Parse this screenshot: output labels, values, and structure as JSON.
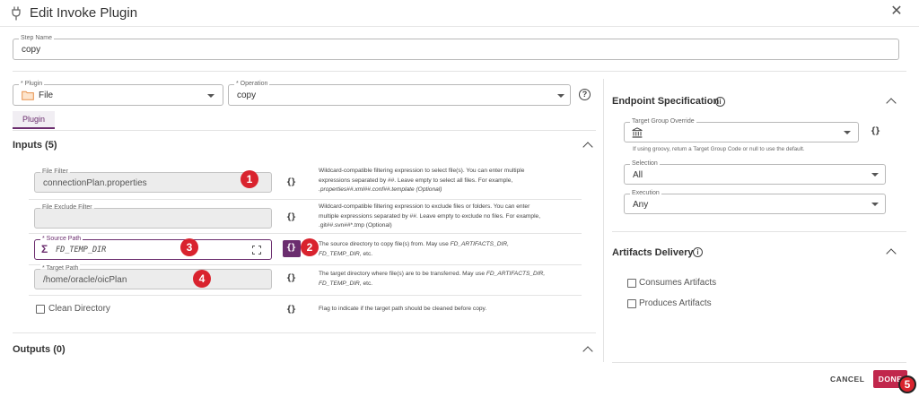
{
  "header": {
    "title": "Edit Invoke Plugin"
  },
  "step_name": {
    "label": "Step Name",
    "value": "copy"
  },
  "plugin": {
    "label": "* Plugin",
    "value": "File"
  },
  "operation": {
    "label": "* Operation",
    "value": "copy"
  },
  "tabs": [
    {
      "label": "Plugin"
    }
  ],
  "inputs": {
    "title": "Inputs (5)",
    "file_filter": {
      "label": "File Filter",
      "value": "connectionPlan.properties",
      "desc_line1": "Wildcard-compatible filtering expression to select file(s). You can enter multiple",
      "desc_line2": "expressions separated by ##. Leave empty to select all files. For example,",
      "desc_line3": ".properties##.xml##.conf##.template (Optional)"
    },
    "file_exclude_filter": {
      "label": "File Exclude Filter",
      "value": "",
      "desc_line1": "Wildcard-compatible filtering expression to exclude files or folders. You can enter",
      "desc_line2": "multiple expressions separated by ##. Leave empty to exclude no files. For example,",
      "desc_line3": ".git##.svn##*.tmp (Optional)"
    },
    "source_path": {
      "label": "* Source Path",
      "value": "FD_TEMP_DIR",
      "desc_line1_prefix": "The source directory to copy file(s) from. May use ",
      "desc_line1_var": "FD_ARTIFACTS_DIR,",
      "desc_line2_var": "FD_TEMP_DIR,",
      "desc_line2_suffix": " etc."
    },
    "target_path": {
      "label": "* Target Path",
      "value": "/home/oracle/oicPlan",
      "desc_line1_prefix": "The target directory where file(s) are to be transferred. May use ",
      "desc_line1_var": "FD_ARTIFACTS_DIR,",
      "desc_line2_var": "FD_TEMP_DIR,",
      "desc_line2_suffix": " etc."
    },
    "clean_directory": {
      "label": "Clean Directory",
      "desc": "Flag to indicate if the target path should be cleaned before copy."
    },
    "braces": "{}"
  },
  "outputs": {
    "title": "Outputs (0)"
  },
  "endpoint": {
    "title": "Endpoint Specification",
    "target_group_override": {
      "label": "Target Group Override",
      "value": ""
    },
    "hint": "If using groovy, return a Target Group Code or null to use the default.",
    "selection": {
      "label": "Selection",
      "value": "All"
    },
    "execution": {
      "label": "Execution",
      "value": "Any"
    }
  },
  "artifacts": {
    "title": "Artifacts Delivery",
    "consumes": "Consumes Artifacts",
    "produces": "Produces Artifacts"
  },
  "footer": {
    "cancel": "CANCEL",
    "done": "DONE"
  },
  "badges": [
    "1",
    "2",
    "3",
    "4",
    "5"
  ],
  "colors": {
    "accent": "#6b2d6e",
    "done": "#c1274c",
    "badge": "#d9232e"
  }
}
